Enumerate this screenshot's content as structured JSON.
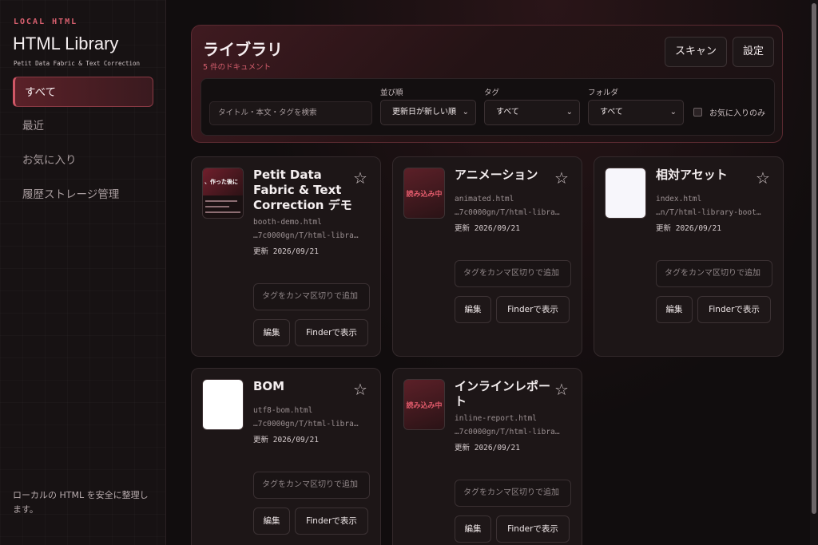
{
  "sidebar": {
    "kicker": "LOCAL HTML",
    "title": "HTML Library",
    "subtitle": "Petit Data Fabric & Text Correction",
    "nav": [
      "すべて",
      "最近",
      "お気に入り",
      "履歴ストレージ管理"
    ],
    "footer": "ローカルの HTML を安全に整理します。"
  },
  "header": {
    "title": "ライブラリ",
    "count": "5 件のドキュメント",
    "scan": "スキャン",
    "settings": "設定"
  },
  "filters": {
    "search_placeholder": "タイトル・本文・タグを検索",
    "sort_label": "並び順",
    "sort_value": "更新日が新しい順",
    "tag_label": "タグ",
    "tag_value": "すべて",
    "folder_label": "フォルダ",
    "folder_value": "すべて",
    "favorites_only": "お気に入りのみ"
  },
  "card_common": {
    "tag_placeholder": "タグをカンマ区切りで追加",
    "edit": "編集",
    "finder": "Finderで表示",
    "loading": "読み込み中",
    "star": "☆"
  },
  "cards": [
    {
      "title": "Petit Data Fabric & Text Correction デモ",
      "file": "booth-demo.html",
      "path": "…7c0000gn/T/html-libra…",
      "updated": "更新 2026/09/21",
      "preview_text": "、作った後に"
    },
    {
      "title": "アニメーション",
      "file": "animated.html",
      "path": "…7c0000gn/T/html-libra…",
      "updated": "更新 2026/09/21"
    },
    {
      "title": "相対アセット",
      "file": "index.html",
      "path": "…n/T/html-library-boot…",
      "updated": "更新 2026/09/21"
    },
    {
      "title": "BOM",
      "file": "utf8-bom.html",
      "path": "…7c0000gn/T/html-libra…",
      "updated": "更新 2026/09/21"
    },
    {
      "title": "インラインレポート",
      "file": "inline-report.html",
      "path": "…7c0000gn/T/html-libra…",
      "updated": "更新 2026/09/21"
    }
  ]
}
